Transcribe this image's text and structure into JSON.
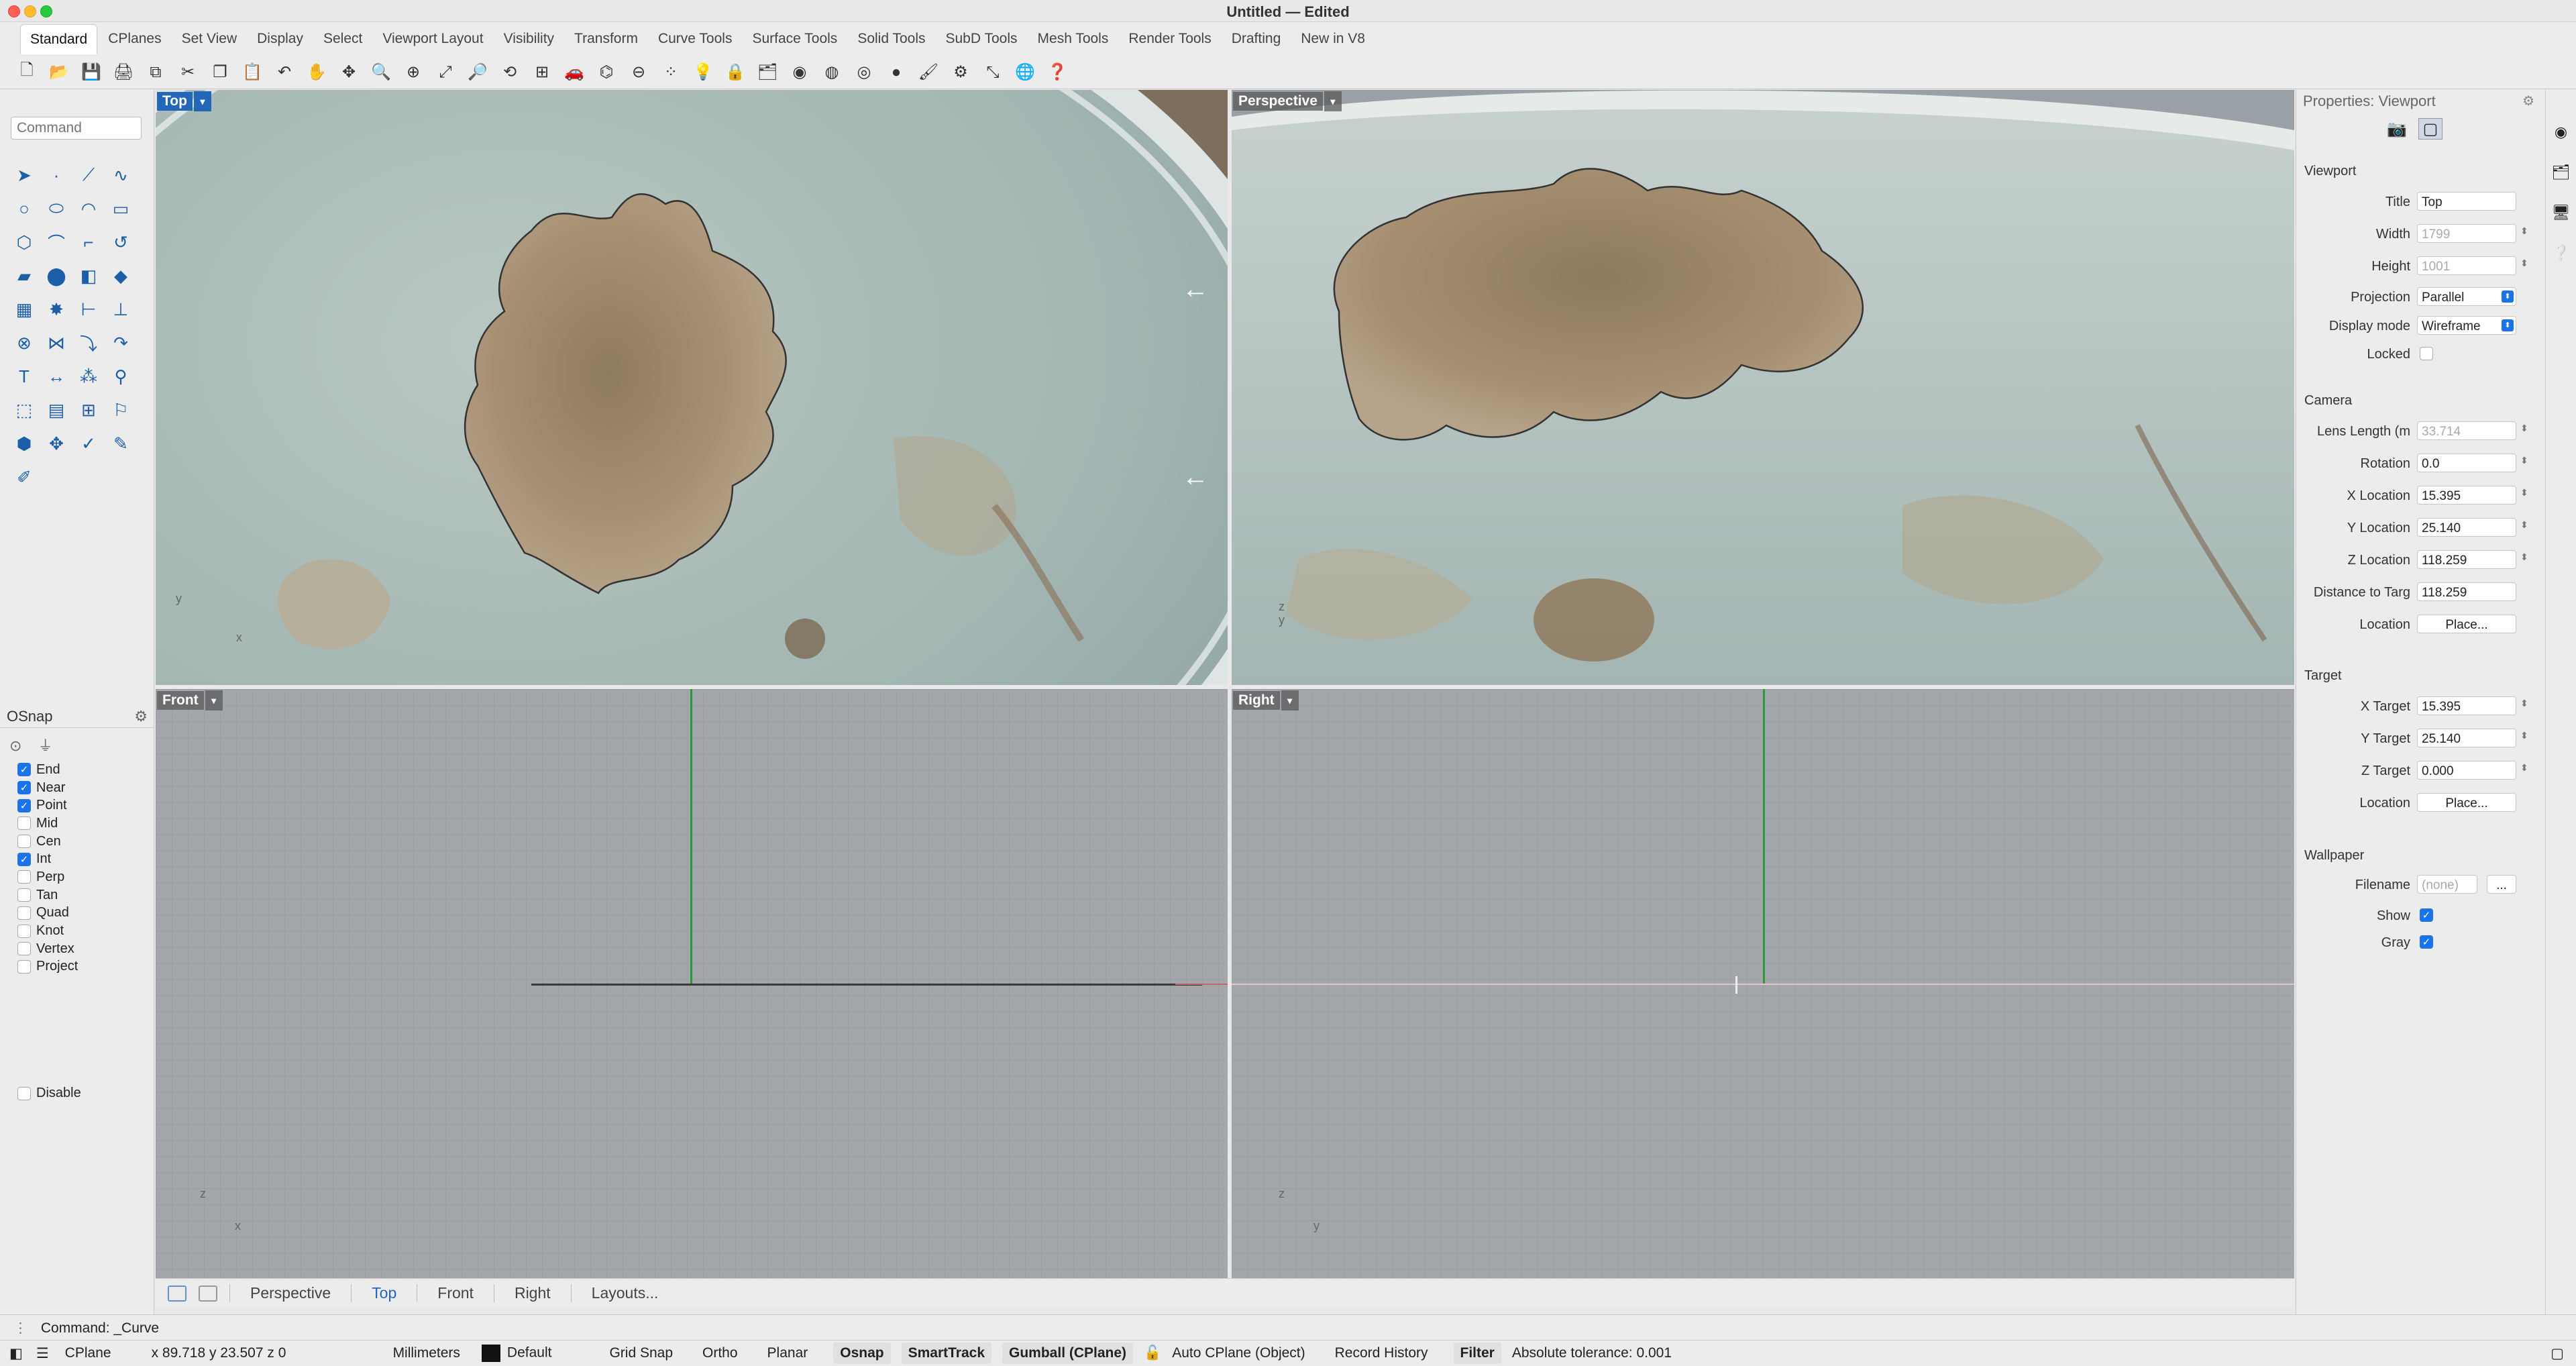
{
  "window": {
    "title": "Untitled — Edited"
  },
  "tabs": [
    "Standard",
    "CPlanes",
    "Set View",
    "Display",
    "Select",
    "Viewport Layout",
    "Visibility",
    "Transform",
    "Curve Tools",
    "Surface Tools",
    "Solid Tools",
    "SubD Tools",
    "Mesh Tools",
    "Render Tools",
    "Drafting",
    "New in V8"
  ],
  "command": {
    "placeholder": "Command",
    "history": "Command: _Curve"
  },
  "osnap": {
    "title": "OSnap",
    "items": [
      {
        "label": "End",
        "checked": true
      },
      {
        "label": "Near",
        "checked": true
      },
      {
        "label": "Point",
        "checked": true
      },
      {
        "label": "Mid",
        "checked": false
      },
      {
        "label": "Cen",
        "checked": false
      },
      {
        "label": "Int",
        "checked": true
      },
      {
        "label": "Perp",
        "checked": false
      },
      {
        "label": "Tan",
        "checked": false
      },
      {
        "label": "Quad",
        "checked": false
      },
      {
        "label": "Knot",
        "checked": false
      },
      {
        "label": "Vertex",
        "checked": false
      },
      {
        "label": "Project",
        "checked": false
      }
    ],
    "disable": "Disable"
  },
  "viewports": {
    "top": "Top",
    "perspective": "Perspective",
    "front": "Front",
    "right": "Right",
    "axis_x": "x",
    "axis_y": "y",
    "axis_z": "z"
  },
  "viewport_tabs": [
    "Perspective",
    "Top",
    "Front",
    "Right",
    "Layouts..."
  ],
  "properties": {
    "title": "Properties: Viewport",
    "viewport_section": "Viewport",
    "title_label": "Title",
    "title_value": "Top",
    "width_label": "Width",
    "width_value": "1799",
    "height_label": "Height",
    "height_value": "1001",
    "projection_label": "Projection",
    "projection_value": "Parallel",
    "display_label": "Display mode",
    "display_value": "Wireframe",
    "locked_label": "Locked",
    "camera_section": "Camera",
    "lens_label": "Lens Length (m",
    "lens_value": "33.714",
    "rotation_label": "Rotation",
    "rotation_value": "0.0",
    "xloc_label": "X Location",
    "xloc_value": "15.395",
    "yloc_label": "Y Location",
    "yloc_value": "25.140",
    "zloc_label": "Z Location",
    "zloc_value": "118.259",
    "dist_label": "Distance to Targ",
    "dist_value": "118.259",
    "location_label": "Location",
    "place_label": "Place...",
    "target_section": "Target",
    "xt_label": "X Target",
    "xt_value": "15.395",
    "yt_label": "Y Target",
    "yt_value": "25.140",
    "zt_label": "Z Target",
    "zt_value": "0.000",
    "tloc_label": "Location",
    "tplace_label": "Place...",
    "wallpaper_section": "Wallpaper",
    "filename_label": "Filename",
    "filename_value": "(none)",
    "browse_label": "...",
    "show_label": "Show",
    "gray_label": "Gray"
  },
  "status": {
    "cplane": "CPlane",
    "coords": "x 89.718   y 23.507   z 0",
    "units": "Millimeters",
    "layer": "Default",
    "grid_snap": "Grid Snap",
    "ortho": "Ortho",
    "planar": "Planar",
    "osnap": "Osnap",
    "smarttrack": "SmartTrack",
    "gumball": "Gumball (CPlane)",
    "autocplane": "Auto CPlane (Object)",
    "record": "Record History",
    "filter": "Filter",
    "tolerance": "Absolute tolerance: 0.001"
  },
  "colors": {
    "accent": "#2466b8",
    "checkbox": "#1a73e8"
  }
}
